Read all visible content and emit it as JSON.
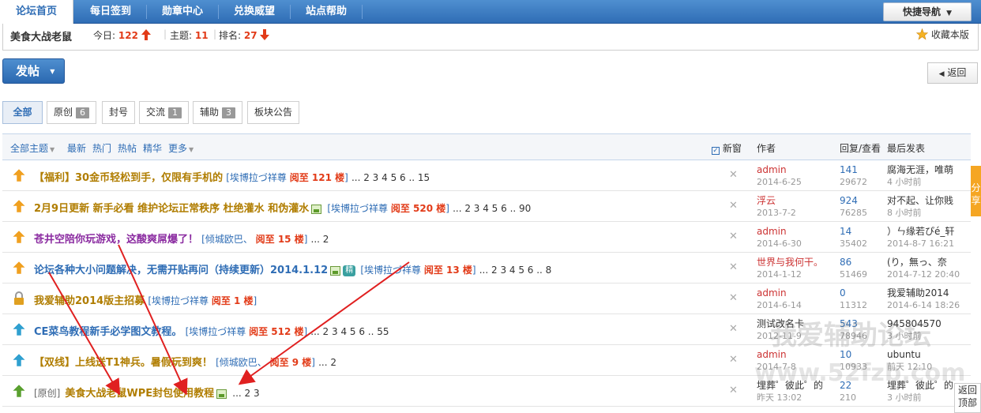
{
  "topnav": {
    "tabs": [
      {
        "label": "论坛首页",
        "active": true
      },
      {
        "label": "每日签到",
        "active": false
      },
      {
        "label": "勋章中心",
        "active": false
      },
      {
        "label": "兑换威望",
        "active": false
      },
      {
        "label": "站点帮助",
        "active": false
      }
    ],
    "quick_nav_label": "快捷导航"
  },
  "forum": {
    "name": "美食大战老鼠",
    "today_label": "今日:",
    "today_value": "122",
    "topics_label": "主题:",
    "topics_value": "11",
    "rank_label": "排名:",
    "rank_value": "27",
    "favorite_label": "收藏本版"
  },
  "actions": {
    "post_label": "发帖",
    "back_label": "返回"
  },
  "type_tabs": [
    {
      "label": "全部",
      "count": "",
      "active": true
    },
    {
      "label": "原创",
      "count": "6",
      "active": false
    },
    {
      "label": "封号",
      "count": "",
      "active": false
    },
    {
      "label": "交流",
      "count": "1",
      "active": false
    },
    {
      "label": "辅助",
      "count": "3",
      "active": false
    },
    {
      "label": "板块公告",
      "count": "",
      "active": false
    }
  ],
  "list_header": {
    "all_topics": "全部主题",
    "filters": [
      "最新",
      "热门",
      "热帖",
      "精华",
      "更多"
    ],
    "new_window": "新窗",
    "author": "作者",
    "replies_views": "回复/查看",
    "last_post": "最后发表"
  },
  "threads": [
    {
      "icon": "announce-icon",
      "icon_color": "#f0a020",
      "prefix": "",
      "title": "【福利】30金币轻松到手，仅限有手机的",
      "title_color": "#b07d00",
      "tag": "[埃博拉づ祥尊 阅至 121 楼]",
      "image": false,
      "jing": false,
      "pages": "... 2 3 4 5 6 .. 15",
      "author": "admin",
      "author_color": "#c33",
      "date": "2014-6-25",
      "replies": "141",
      "views": "29672",
      "last_user": "腐海无涯，唯萌",
      "last_time": "4 小时前"
    },
    {
      "icon": "announce-icon",
      "icon_color": "#f0a020",
      "prefix": "",
      "title": "2月9日更新 新手必看 维护论坛正常秩序 杜绝灌水 和伪灌水",
      "title_color": "#b07d00",
      "tag": "[埃博拉づ祥尊 阅至 520 楼]",
      "image": true,
      "jing": false,
      "pages": "... 2 3 4 5 6 .. 90",
      "author": "浮云",
      "author_color": "#c33",
      "date": "2013-7-2",
      "replies": "924",
      "views": "76285",
      "last_user": "对不起、让你贱",
      "last_time": "8 小时前"
    },
    {
      "icon": "announce-icon",
      "icon_color": "#f0a020",
      "prefix": "",
      "title": "苍井空陪你玩游戏，这酸爽屌爆了！",
      "title_color": "#8a2aa0",
      "tag": "[倾城欧巴、 阅至 15 楼]",
      "image": false,
      "jing": false,
      "pages": "... 2",
      "author": "admin",
      "author_color": "#c33",
      "date": "2014-6-30",
      "replies": "14",
      "views": "35402",
      "last_user": "）ㄣ缘若ぴé_轩",
      "last_time": "2014-8-7 16:21"
    },
    {
      "icon": "announce-icon",
      "icon_color": "#f0a020",
      "prefix": "",
      "title": "论坛各种大小问题解决，无需开贴再问（持续更新）2014.1.12",
      "title_color": "#2f6db5",
      "tag": "[埃博拉づ祥尊 阅至 13 楼]",
      "image": true,
      "jing": true,
      "jing_label": "精",
      "pages": "... 2 3 4 5 6 .. 8",
      "author": "世界与我何干。",
      "author_color": "#c33",
      "date": "2014-1-12",
      "replies": "86",
      "views": "51469",
      "last_user": "(り，無っ、奈",
      "last_time": "2014-7-12 20:40"
    },
    {
      "icon": "lock-icon",
      "icon_color": "#e0a020",
      "prefix": "",
      "title": "我爱辅助2014版主招募",
      "title_color": "#b07d00",
      "tag": "[埃博拉づ祥尊 阅至 1 楼]",
      "image": false,
      "jing": false,
      "pages": "",
      "author": "admin",
      "author_color": "#c33",
      "date": "2014-6-14",
      "replies": "0",
      "views": "11312",
      "last_user": "我爱辅助2014",
      "last_time": "2014-6-14 18:26"
    },
    {
      "icon": "announce-icon",
      "icon_color": "#30a0d0",
      "prefix": "",
      "title": "CE菜鸟教程新手必学图文教程。",
      "title_color": "#2f6db5",
      "tag": "[埃博拉づ祥尊 阅至 512 楼]",
      "image": false,
      "jing": false,
      "pages": "... 2 3 4 5 6 .. 55",
      "author": "测试改名卡",
      "author_color": "#333",
      "date": "2012-11-9",
      "replies": "543",
      "views": "78946",
      "last_user": "945804570",
      "last_time": "3 小时前"
    },
    {
      "icon": "announce-icon",
      "icon_color": "#30a0d0",
      "prefix": "",
      "title": "【双线】上线送T1神兵。暑假玩到爽！",
      "title_color": "#b07d00",
      "tag": "[倾城欧巴、 阅至 9 楼]",
      "image": false,
      "jing": false,
      "pages": "... 2",
      "author": "admin",
      "author_color": "#c33",
      "date": "2014-7-8",
      "replies": "10",
      "views": "10933",
      "last_user": "ubuntu",
      "last_time": "前天 12:10"
    },
    {
      "icon": "thread-icon",
      "icon_color": "#5aa030",
      "prefix": "[原创]",
      "title": "美食大战老鼠WPE封包使用教程",
      "title_color": "#b07d00",
      "tag": "",
      "image": true,
      "jing": false,
      "pages": "... 2 3",
      "author": "埋葬゜彼此゜的",
      "author_color": "#333",
      "date": "昨天 13:02",
      "replies": "22",
      "views": "210",
      "last_user": "埋葬゜彼此゜的",
      "last_time": "3 小时前"
    }
  ],
  "side": {
    "share_label": "分享",
    "back_top_label": "返回顶部"
  },
  "watermark": {
    "title": "我爱辅助论坛",
    "url": "www.52fzb.com"
  },
  "colors": {
    "nav_blue": "#2f6db5",
    "highlight_red": "#e23b18",
    "arrow_red": "#e02020"
  }
}
